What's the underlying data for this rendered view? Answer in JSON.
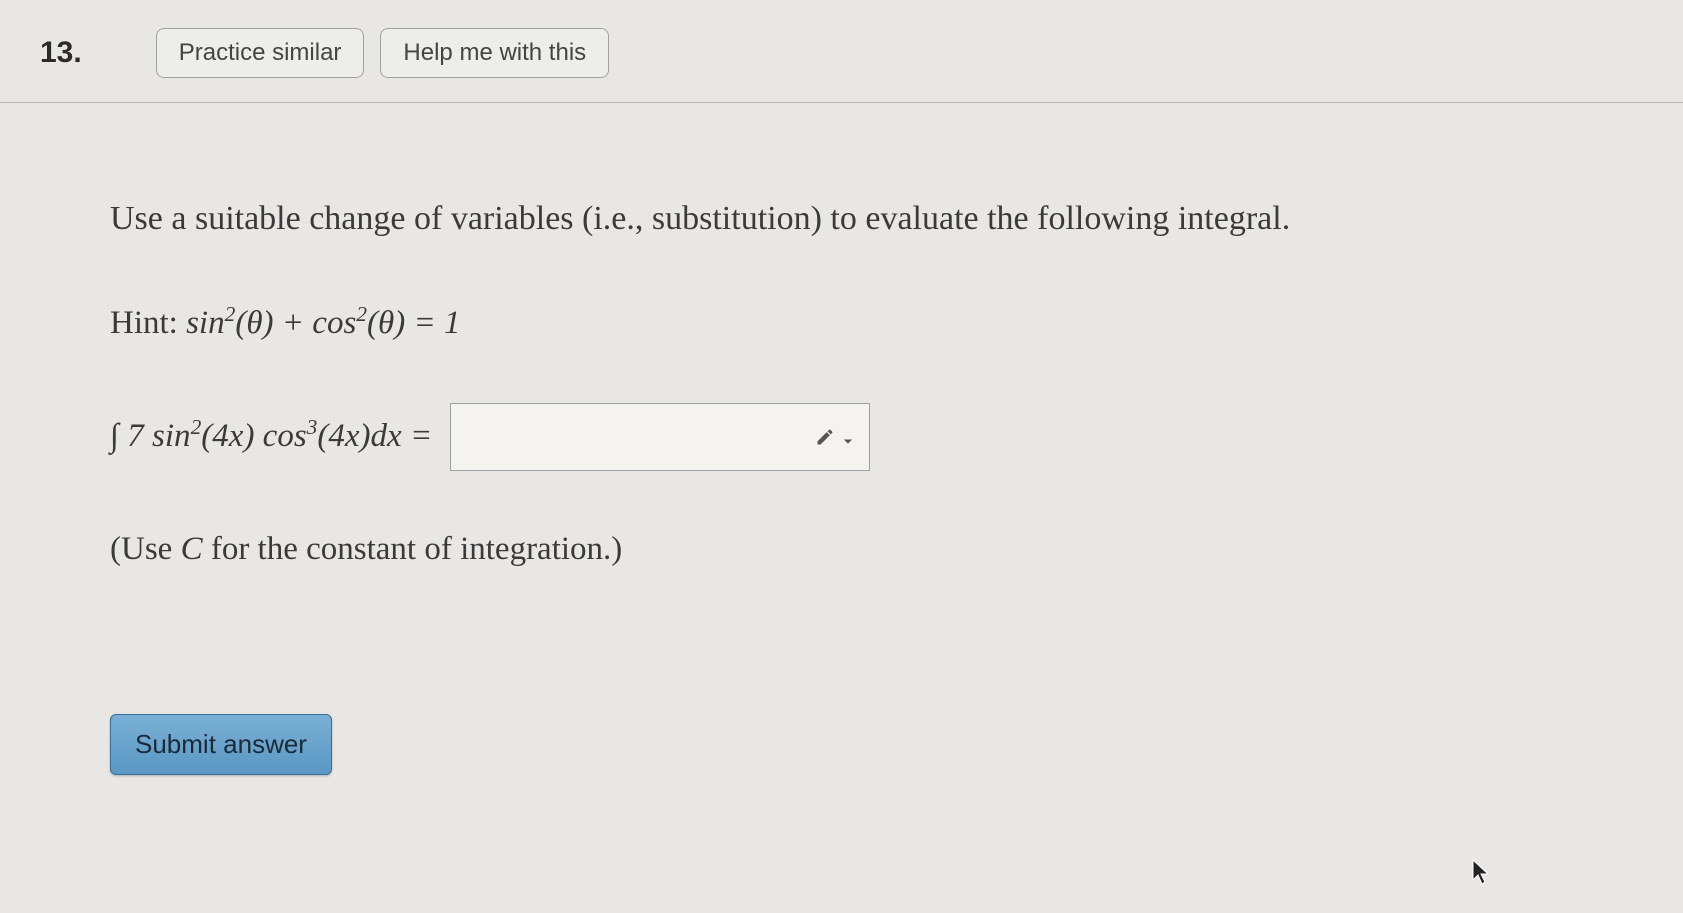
{
  "header": {
    "question_number": "13.",
    "practice_label": "Practice similar",
    "help_label": "Help me with this"
  },
  "body": {
    "prompt": "Use a suitable change of variables (i.e., substitution) to evaluate the following integral.",
    "hint_prefix": "Hint: ",
    "hint_math": "sin²(θ) + cos²(θ) = 1",
    "integral_expr": "∫ 7 sin²(4x) cos³(4x) dx =",
    "answer_value": "",
    "note": "(Use C for the constant of integration.)",
    "submit_label": "Submit answer"
  }
}
